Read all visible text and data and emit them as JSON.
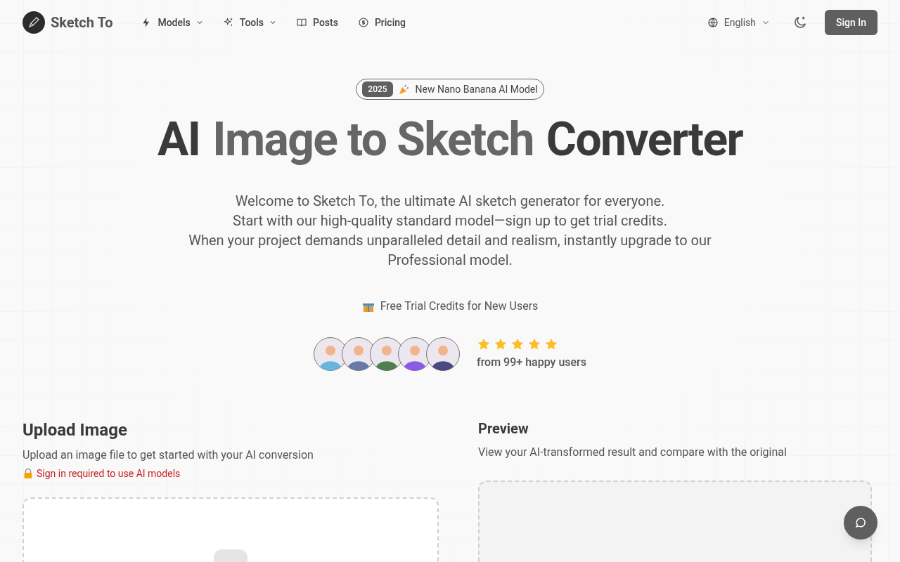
{
  "header": {
    "brand": "Sketch To",
    "nav": [
      {
        "label": "Models",
        "kind": "bolt",
        "dropdown": true
      },
      {
        "label": "Tools",
        "kind": "sparkles",
        "dropdown": true
      },
      {
        "label": "Posts",
        "kind": "book",
        "dropdown": false
      },
      {
        "label": "Pricing",
        "kind": "dollar",
        "dropdown": false
      }
    ],
    "language": "English",
    "sign_in": "Sign In"
  },
  "hero": {
    "badge_year": "2025",
    "badge_text": "New Nano Banana AI Model",
    "title": [
      {
        "text": "AI",
        "kind": "plain"
      },
      {
        "text": "Image to Sketch",
        "kind": "accent"
      },
      {
        "text": "Converter",
        "kind": "plain"
      }
    ],
    "description": [
      "Welcome to Sketch To, the ultimate AI sketch generator for everyone.",
      "Start with our high-quality standard model—sign up to get trial credits.",
      "When your project demands unparalleled detail and realism, instantly upgrade to our Professional model."
    ],
    "trial_note": "Free Trial Credits for New Users",
    "stars": 5,
    "users_text": "from 99+ happy users"
  },
  "upload": {
    "title": "Upload Image",
    "subtitle": "Upload an image file to get started with your AI conversion",
    "warning": "Sign in required to use AI models"
  },
  "preview": {
    "title": "Preview",
    "subtitle": "View your AI-transformed result and compare with the original"
  }
}
